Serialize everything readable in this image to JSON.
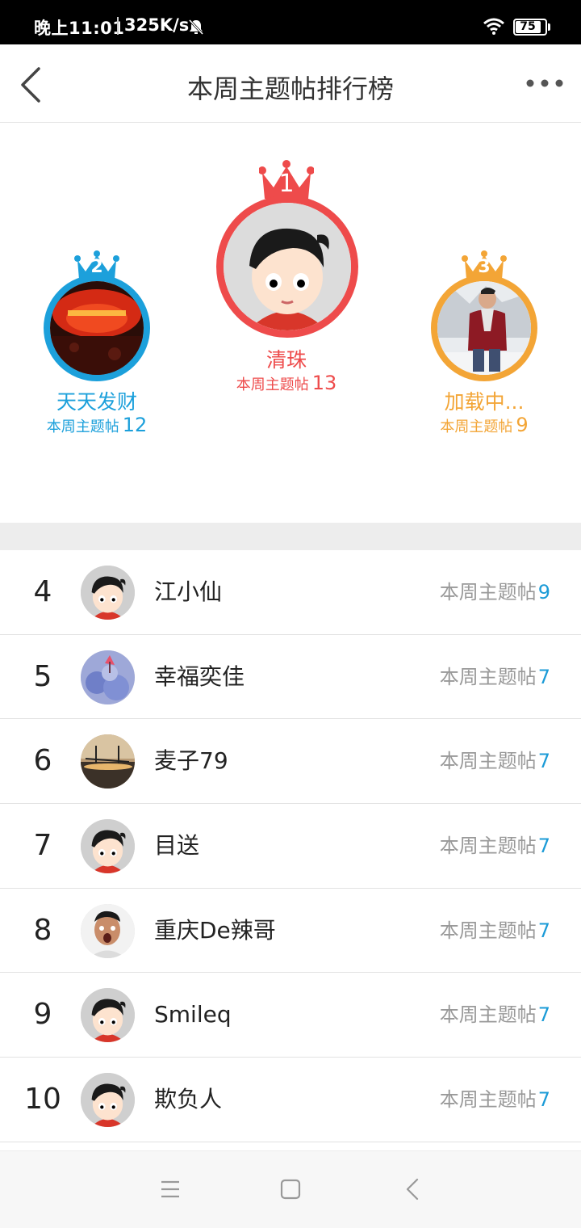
{
  "status_bar": {
    "time": "晚上11:01",
    "net_speed": "325K/s",
    "battery": "75",
    "icons": [
      "mute-icon",
      "wifi-icon",
      "battery-icon"
    ]
  },
  "header": {
    "title": "本周主题帖排行榜",
    "back_icon": "chevron-left-icon",
    "more_icon": "more-dots-icon"
  },
  "podium": [
    {
      "rank": "1",
      "name": "清珠",
      "count_label": "本周主题帖",
      "count": "13",
      "color": "#ee4b4b"
    },
    {
      "rank": "2",
      "name": "天天发财",
      "count_label": "本周主题帖",
      "count": "12",
      "color": "#1ca0db"
    },
    {
      "rank": "3",
      "name": "加载中...",
      "count_label": "本周主题帖",
      "count": "9",
      "color": "#f3a536"
    }
  ],
  "list": [
    {
      "rank": "4",
      "name": "江小仙",
      "count_label": "本周主题帖",
      "count": "9"
    },
    {
      "rank": "5",
      "name": "幸福奕佳",
      "count_label": "本周主题帖",
      "count": "7"
    },
    {
      "rank": "6",
      "name": "麦子79",
      "count_label": "本周主题帖",
      "count": "7"
    },
    {
      "rank": "7",
      "name": "目送",
      "count_label": "本周主题帖",
      "count": "7"
    },
    {
      "rank": "8",
      "name": "重庆De辣哥",
      "count_label": "本周主题帖",
      "count": "7"
    },
    {
      "rank": "9",
      "name": "Smileq",
      "count_label": "本周主题帖",
      "count": "7"
    },
    {
      "rank": "10",
      "name": "欺负人",
      "count_label": "本周主题帖",
      "count": "7"
    }
  ],
  "nav_bar": {
    "icons": [
      "menu-icon",
      "home-square-icon",
      "back-triangle-icon"
    ]
  },
  "colors": {
    "accent_blue": "#1b9bd7",
    "gold": "#f3a536",
    "red": "#ee4b4b",
    "muted_text": "#999999"
  }
}
